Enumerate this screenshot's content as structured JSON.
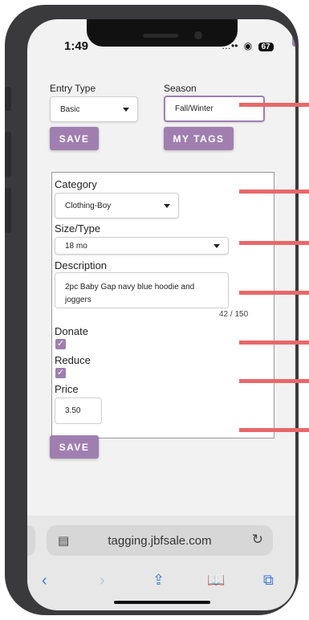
{
  "status": {
    "time": "1:49",
    "signal": "…••",
    "wifi": "◉",
    "battery": "67"
  },
  "form": {
    "entry_type": {
      "label": "Entry Type",
      "value": "Basic"
    },
    "season": {
      "label": "Season",
      "value": "Fall/Winter"
    },
    "save_label": "SAVE",
    "my_tags_label": "MY TAGS",
    "category": {
      "label": "Category",
      "value": "Clothing-Boy"
    },
    "size_type": {
      "label": "Size/Type",
      "value": "18 mo"
    },
    "description": {
      "label": "Description",
      "line1": "2pc Baby Gap navy blue hoodie and",
      "line2": "joggers",
      "counter": "42 / 150"
    },
    "donate": {
      "label": "Donate",
      "checked": true
    },
    "reduce": {
      "label": "Reduce",
      "checked": true
    },
    "price": {
      "label": "Price",
      "value": "3.50"
    },
    "bottom_save_label": "SAVE"
  },
  "browser": {
    "url": "tagging.jbfsale.com"
  },
  "colors": {
    "accent": "#a07fb0",
    "annotation": "#e8686a",
    "browser_link": "#3a78e0"
  }
}
